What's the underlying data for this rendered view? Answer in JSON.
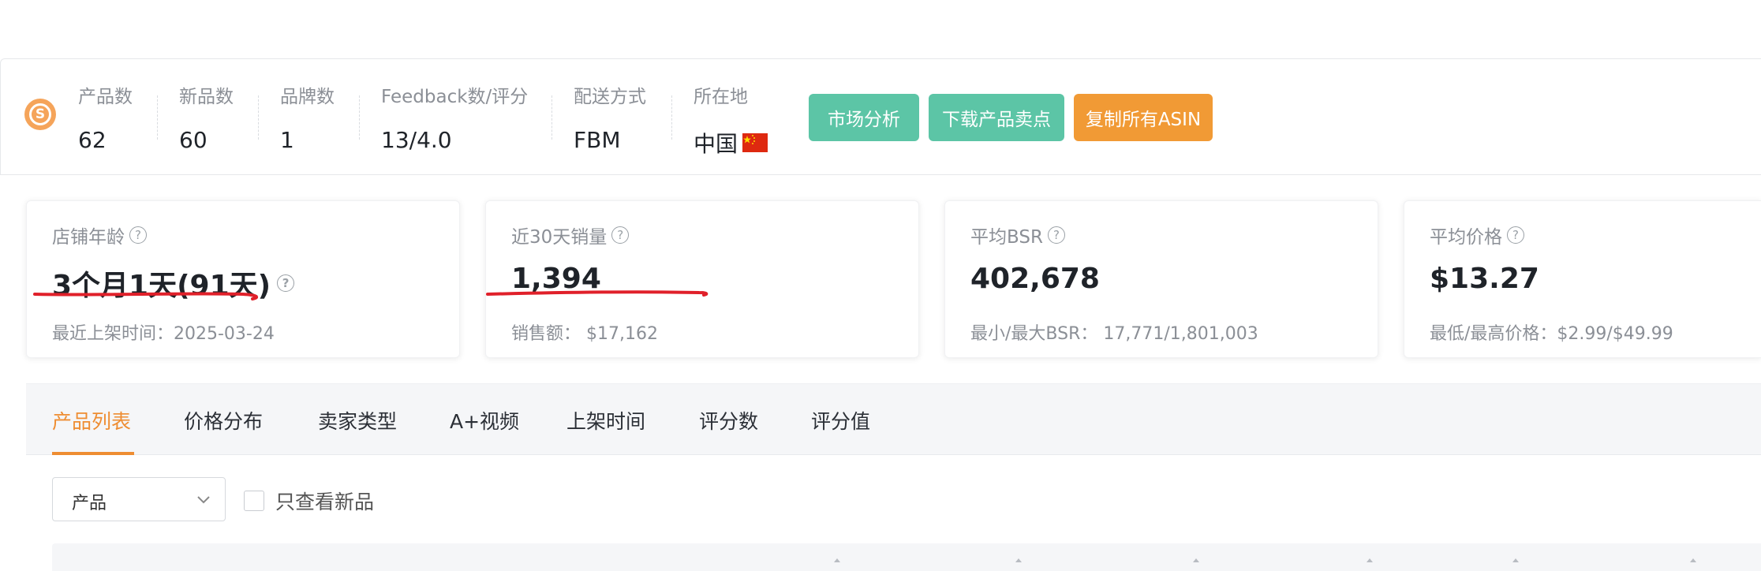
{
  "store": {
    "logo_icon": "store-s-icon",
    "logo_letter": "S",
    "stats": [
      {
        "label": "产品数",
        "value": "62"
      },
      {
        "label": "新品数",
        "value": "60"
      },
      {
        "label": "品牌数",
        "value": "1"
      },
      {
        "label": "Feedback数/评分",
        "value": "13/4.0"
      },
      {
        "label": "配送方式",
        "value": "FBM"
      },
      {
        "label": "所在地",
        "value": "中国"
      }
    ],
    "buttons": {
      "market_analysis": "市场分析",
      "download_selling_points": "下载产品卖点",
      "copy_all_asin": "复制所有ASIN"
    }
  },
  "metrics": [
    {
      "label": "店铺年龄",
      "value": "3个月1天(91天)",
      "sub": "最近上架时间：2025-03-24"
    },
    {
      "label": "近30天销量",
      "value": "1,394",
      "sub": "销售额：  $17,162"
    },
    {
      "label": "平均BSR",
      "value": "402,678",
      "sub": "最小/最大BSR：  17,771/1,801,003"
    },
    {
      "label": "平均价格",
      "value": "$13.27",
      "sub": "最低/最高价格：$2.99/$49.99"
    }
  ],
  "tabs": [
    "产品列表",
    "价格分布",
    "卖家类型",
    "A+视频",
    "上架时间",
    "评分数",
    "评分值"
  ],
  "active_tab": "产品列表",
  "filter": {
    "select_value": "产品",
    "checkbox_label": "只查看新品",
    "checkbox_checked": false
  },
  "colors": {
    "green_button": "#5cc5a6",
    "orange_button": "#f19a35",
    "active_tab": "#ee8d32",
    "annotation_red": "#e0202a"
  }
}
